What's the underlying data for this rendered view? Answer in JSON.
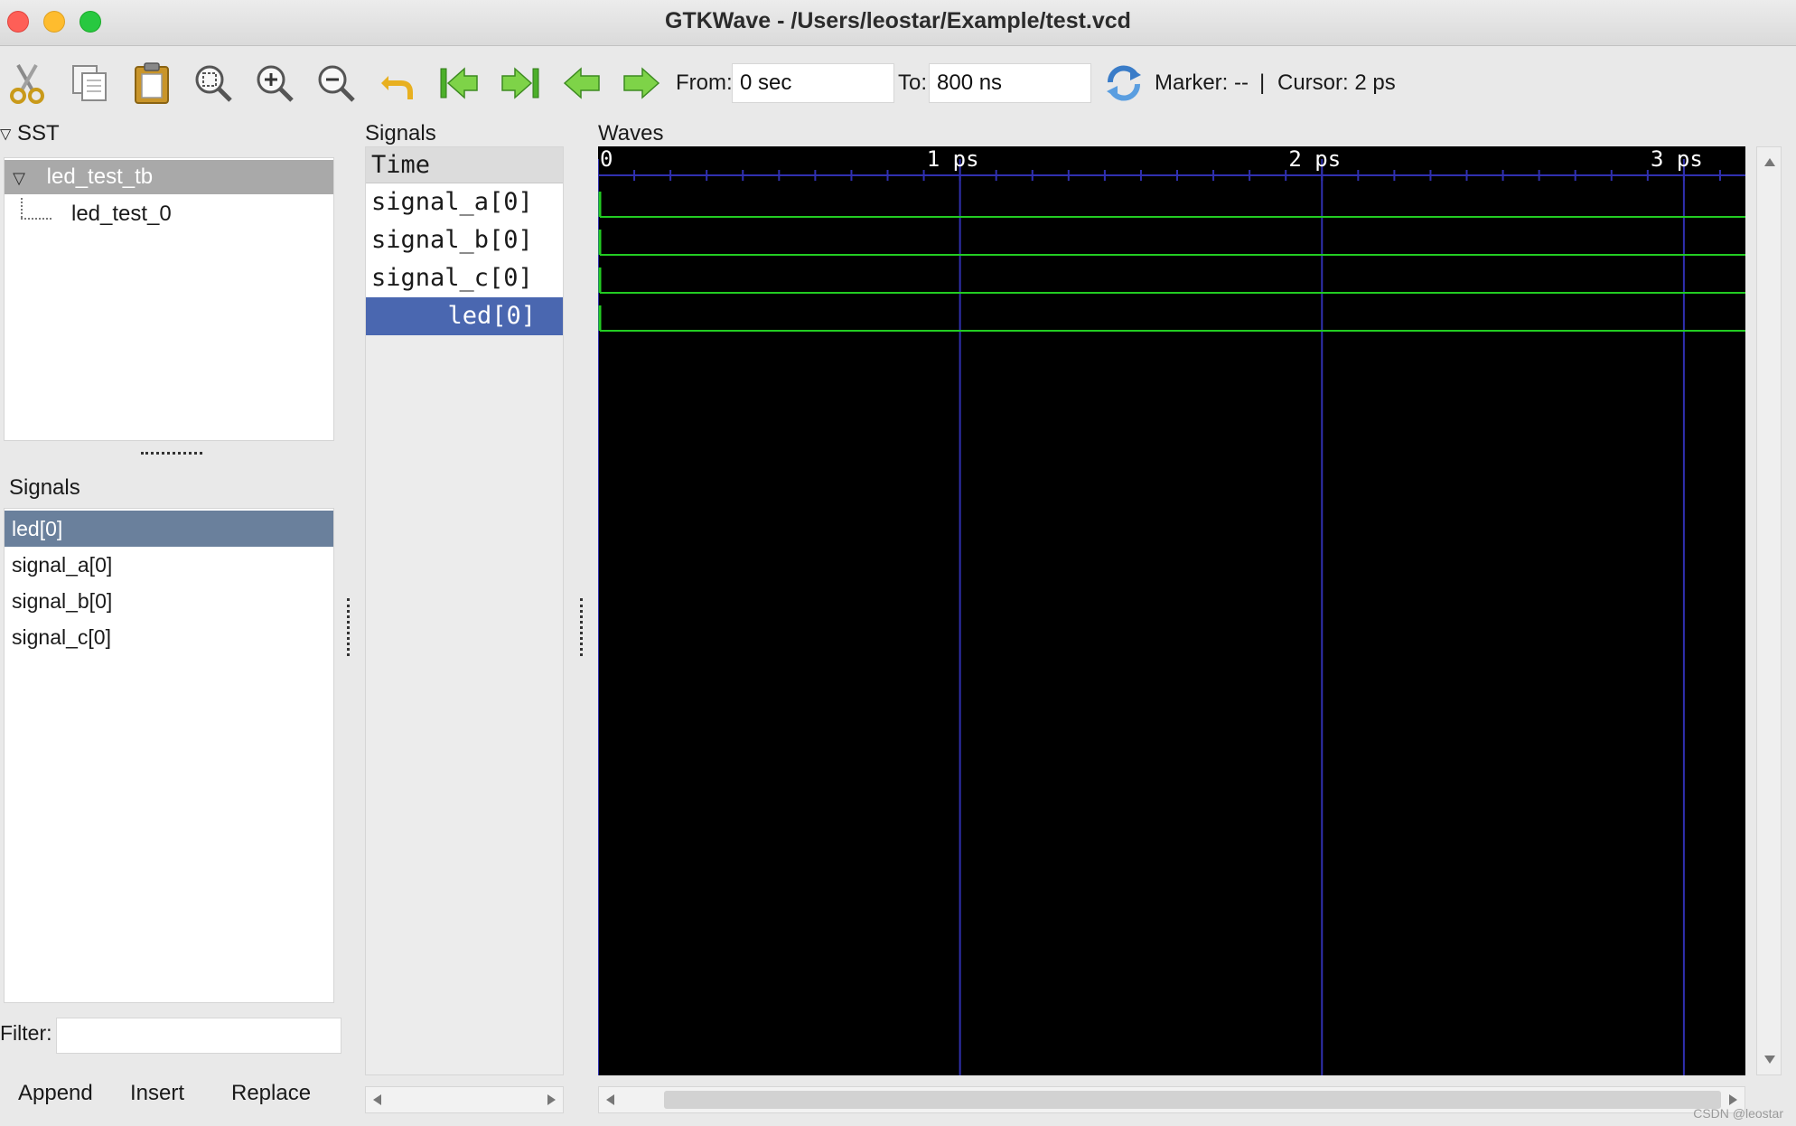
{
  "window": {
    "title": "GTKWave - /Users/leostar/Example/test.vcd"
  },
  "toolbar": {
    "icons": [
      "cut-icon",
      "copy-icon",
      "paste-icon",
      "zoom-fit-icon",
      "zoom-in-icon",
      "zoom-out-icon",
      "undo-icon",
      "go-to-start-icon",
      "go-to-end-icon",
      "step-back-icon",
      "step-forward-icon",
      "reload-icon"
    ],
    "from_label": "From:",
    "from_value": "0 sec",
    "to_label": "To:",
    "to_value": "800 ns",
    "marker_text": "Marker: --",
    "separator": "|",
    "cursor_text": "Cursor: 2 ps"
  },
  "sst": {
    "label": "SST",
    "tree": {
      "root": "led_test_tb",
      "child": "led_test_0"
    }
  },
  "signals_panel": {
    "label": "Signals",
    "items": [
      "led[0]",
      "signal_a[0]",
      "signal_b[0]",
      "signal_c[0]"
    ],
    "selected": "led[0]",
    "filter_label": "Filter:",
    "filter_value": "",
    "buttons": {
      "append": "Append",
      "insert": "Insert",
      "replace": "Replace"
    }
  },
  "names_panel": {
    "label": "Signals",
    "header": "Time",
    "rows": [
      "signal_a[0]",
      "signal_b[0]",
      "signal_c[0]",
      "led[0]"
    ],
    "selected": "led[0]"
  },
  "waves": {
    "label": "Waves",
    "time_labels": [
      "0",
      "1 ps",
      "2 ps",
      "3 ps"
    ],
    "time_major_ps": [
      0,
      1,
      2,
      3
    ],
    "visible_range_ps": [
      0,
      3.17
    ],
    "minor_ticks_per_major": 10,
    "signal_rows": 4,
    "trace_color": "#22cc22",
    "grid_color": "#3030b0",
    "background_color": "#000000"
  },
  "watermark": "CSDN @leostar"
}
